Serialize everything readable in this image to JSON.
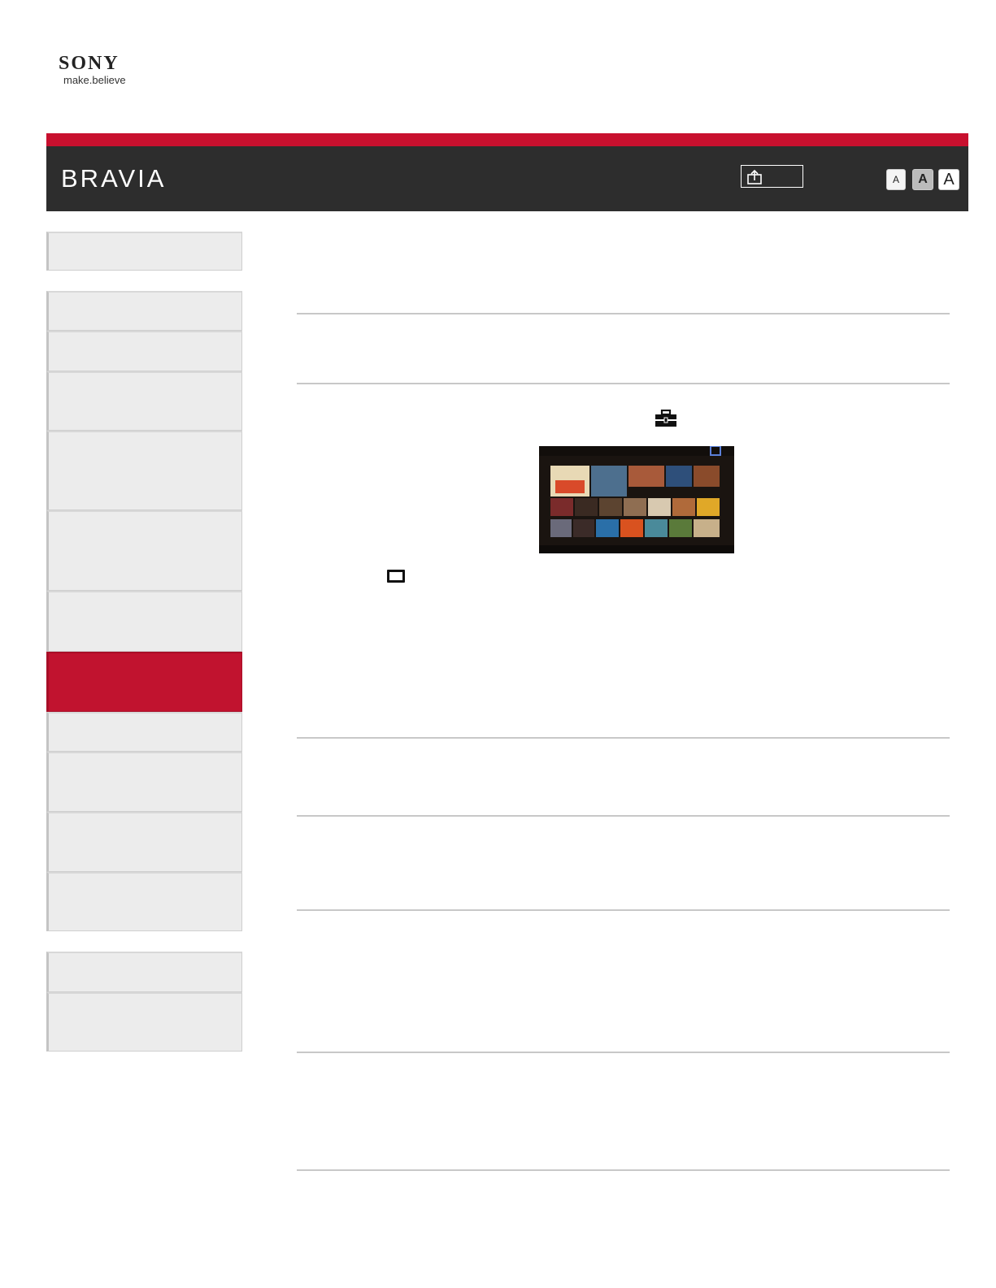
{
  "logo": {
    "brand": "SONY",
    "tagline": "make.believe"
  },
  "header": {
    "title": "BRAVIA",
    "print_icon": "print-icon",
    "font_sizes": [
      "A",
      "A",
      "A"
    ]
  },
  "colors": {
    "accent_red": "#c8102e",
    "header_bg": "#2d2d2d",
    "nav_bg": "#ececec",
    "nav_active": "#c1132f"
  },
  "sidebar": {
    "item_count": 14,
    "active_index": 7
  },
  "content": {
    "toolbox_icon": "toolbox-icon",
    "screenshot": "tv-home-menu-screenshot",
    "options_icon": "options-button-icon"
  }
}
